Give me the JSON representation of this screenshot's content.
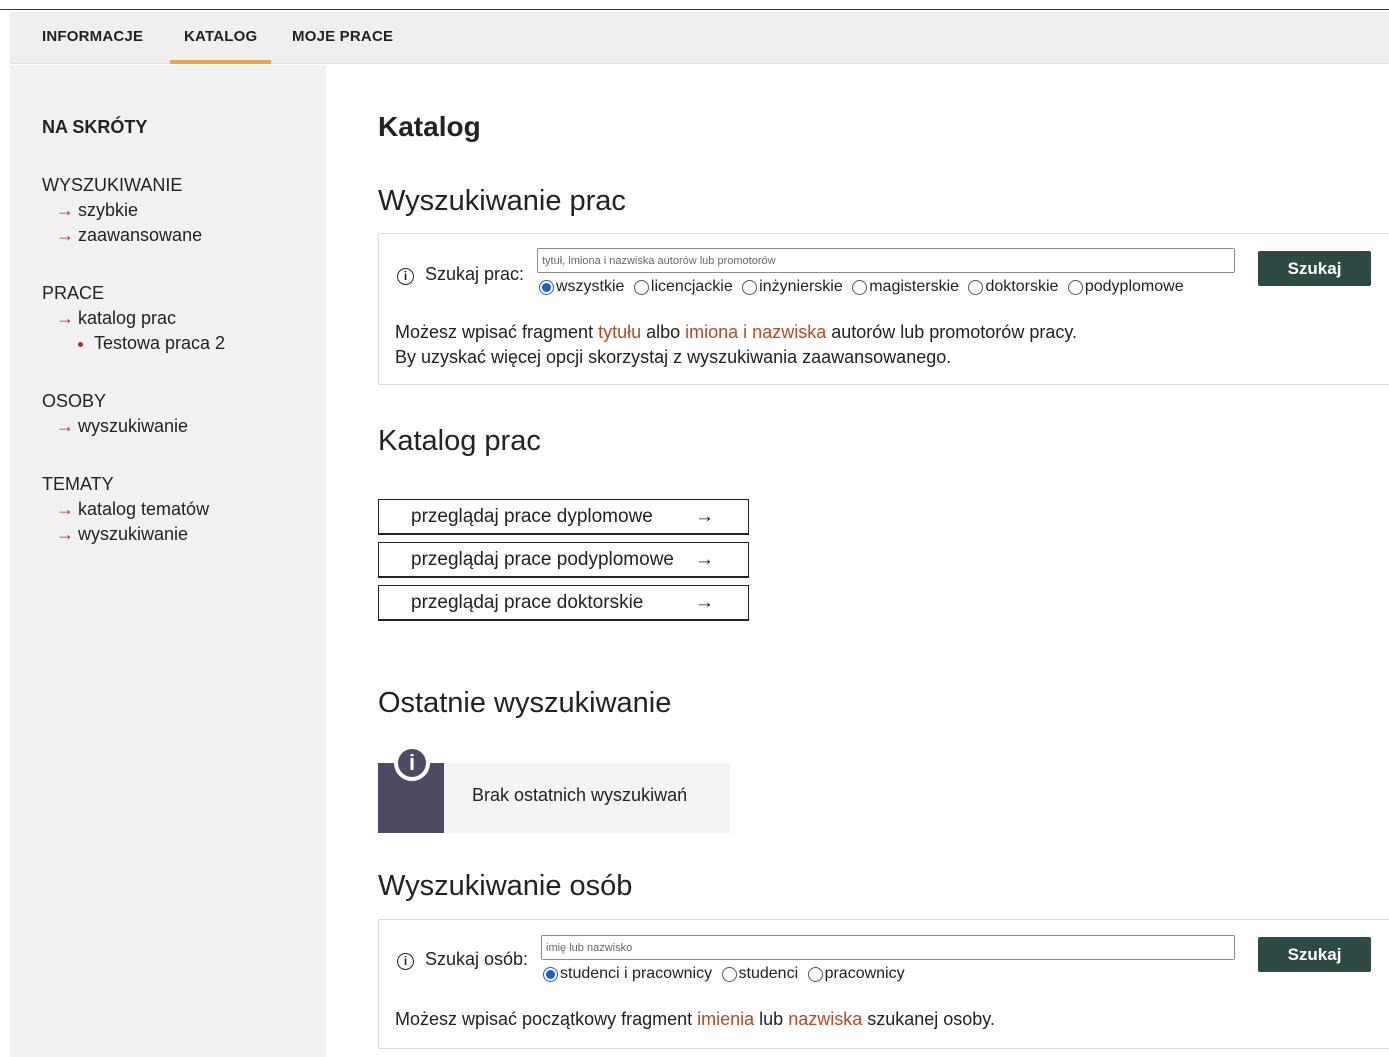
{
  "nav": {
    "tabs": [
      {
        "label": "INFORMACJE"
      },
      {
        "label": "KATALOG",
        "active": true
      },
      {
        "label": "MOJE PRACE"
      }
    ]
  },
  "sidebar": {
    "title": "NA SKRÓTY",
    "groups": [
      {
        "head": "WYSZUKIWANIE",
        "items": [
          "szybkie",
          "zaawansowane"
        ]
      },
      {
        "head": "PRACE",
        "items": [
          "katalog prac"
        ],
        "sub": [
          "Testowa praca 2"
        ]
      },
      {
        "head": "OSOBY",
        "items": [
          "wyszukiwanie"
        ]
      },
      {
        "head": "TEMATY",
        "items": [
          "katalog tematów",
          "wyszukiwanie"
        ]
      }
    ],
    "arrow": "→"
  },
  "main": {
    "title": "Katalog",
    "works_search": {
      "heading": "Wyszukiwanie prac",
      "label": "Szukaj prac:",
      "placeholder": "tytuł, imiona i nazwiska autorów lub promotorów",
      "button": "Szukaj",
      "radios": [
        "wszystkie",
        "licencjackie",
        "inżynierskie",
        "magisterskie",
        "doktorskie",
        "podyplomowe"
      ],
      "selected": "wszystkie",
      "hint1_a": "Możesz wpisać fragment ",
      "hint1_b": "tytułu",
      "hint1_c": " albo ",
      "hint1_d": "imiona i nazwiska",
      "hint1_e": " autorów lub promotorów pracy.",
      "hint2": "By uzyskać więcej opcji skorzystaj z wyszukiwania zaawansowanego."
    },
    "catalog": {
      "heading": "Katalog prac",
      "buttons": [
        "przeglądaj prace dyplomowe",
        "przeglądaj prace podyplomowe",
        "przeglądaj prace doktorskie"
      ],
      "arrow": "→"
    },
    "recent": {
      "heading": "Ostatnie wyszukiwanie",
      "empty": "Brak ostatnich wyszukiwań"
    },
    "people_search": {
      "heading": "Wyszukiwanie osób",
      "label": "Szukaj osób:",
      "placeholder": "imię lub nazwisko",
      "button": "Szukaj",
      "radios": [
        "studenci i pracownicy",
        "studenci",
        "pracownicy"
      ],
      "selected": "studenci i pracownicy",
      "hint_a": "Możesz wpisać początkowy fragment ",
      "hint_b": "imienia",
      "hint_c": " lub ",
      "hint_d": "nazwiska",
      "hint_e": " szukanej osoby."
    }
  },
  "colors": {
    "accent_tab": "#f0a24a",
    "arrow_red": "#b3332a",
    "button_bg": "#2e4a44",
    "highlight": "#b44a1e",
    "info_panel": "#4f4a63"
  },
  "icons": {
    "info": "info-icon",
    "arrow": "arrow-right-icon"
  }
}
